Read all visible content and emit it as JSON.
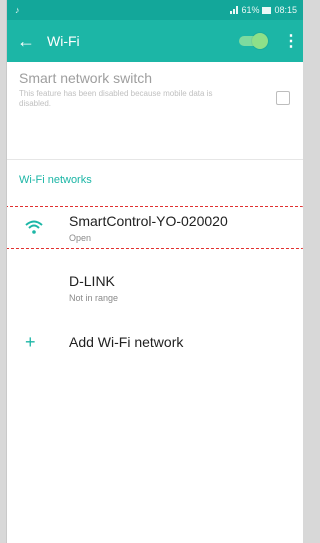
{
  "statusbar": {
    "left_icon": "notification-icon",
    "battery_percent": "61%",
    "time": "08:15"
  },
  "appbar": {
    "back_icon": "arrow-left-icon",
    "title": "Wi-Fi",
    "toggle_on": true,
    "menu_icon": "more-vert-icon"
  },
  "smart_switch": {
    "title": "Smart network switch",
    "description": "This feature has been disabled because mobile data is disabled.",
    "checked": false
  },
  "section_title": "Wi-Fi networks",
  "networks": [
    {
      "name": "SmartControl-YO-020020",
      "status": "Open",
      "icon": "wifi-icon"
    },
    {
      "name": "D-LINK",
      "status": "Not in range"
    }
  ],
  "add_network": {
    "icon": "plus-icon",
    "label": "Add Wi-Fi network"
  },
  "colors": {
    "accent": "#1cb6a6",
    "statusbar": "#13a79a",
    "highlight": "#e2302f"
  }
}
